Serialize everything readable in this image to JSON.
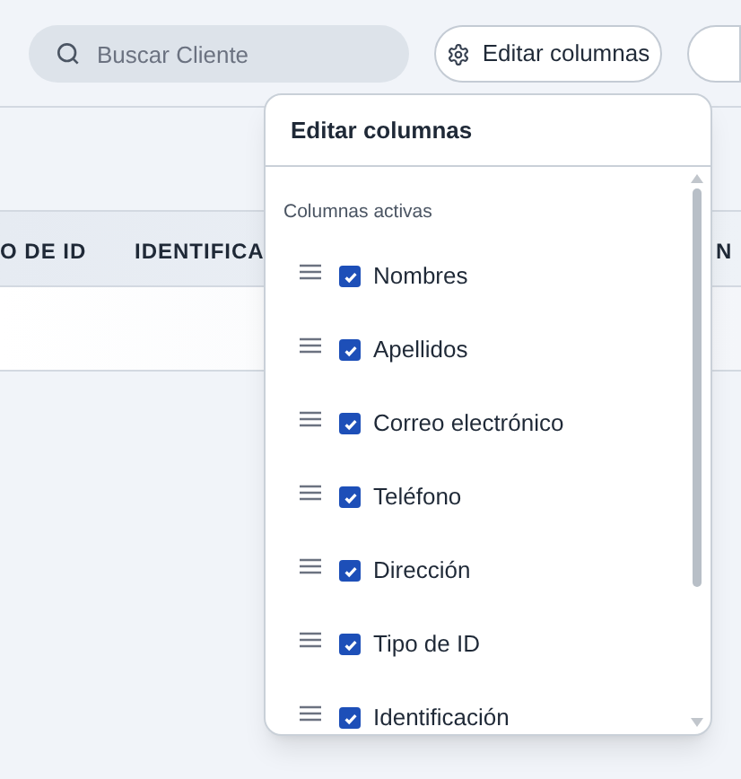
{
  "search": {
    "placeholder": "Buscar Cliente"
  },
  "edit_columns_button": {
    "label": "Editar columnas"
  },
  "table": {
    "columns": [
      "O DE ID",
      "IDENTIFICA",
      "N"
    ]
  },
  "popup": {
    "title": "Editar columnas",
    "section": "Columnas activas",
    "columns": [
      {
        "label": "Nombres",
        "checked": true
      },
      {
        "label": "Apellidos",
        "checked": true
      },
      {
        "label": "Correo electrónico",
        "checked": true
      },
      {
        "label": "Teléfono",
        "checked": true
      },
      {
        "label": "Dirección",
        "checked": true
      },
      {
        "label": "Tipo de ID",
        "checked": true
      },
      {
        "label": "Identificación",
        "checked": true
      }
    ]
  }
}
